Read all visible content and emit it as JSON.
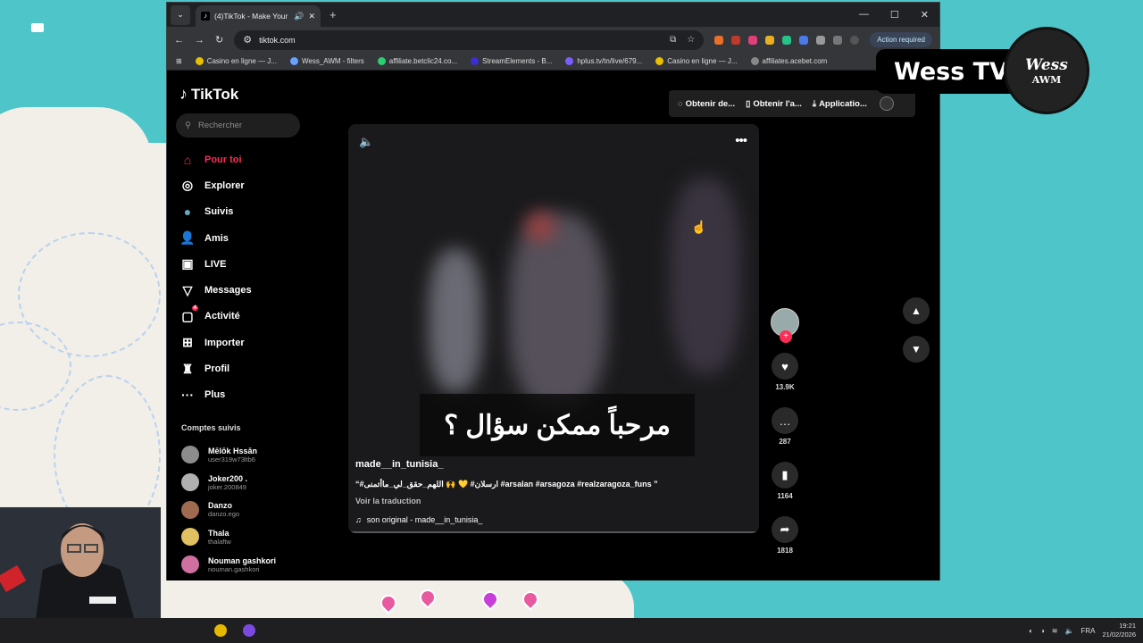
{
  "browser": {
    "tab_title": "(4)TikTok - Make Your Day",
    "url": "tiktok.com",
    "action_required": "Action required",
    "bookmarks": [
      {
        "label": "Casino en ligne — J...",
        "color": "#e8c000"
      },
      {
        "label": "Wess_AWM - filters",
        "color": "#6aa0ff"
      },
      {
        "label": "affiliate.betclic24.co...",
        "color": "#2ecc71"
      },
      {
        "label": "StreamElements - B...",
        "color": "#3a2fd0"
      },
      {
        "label": "hplus.tv/tn/live/679...",
        "color": "#7b5cff"
      },
      {
        "label": "Casino en ligne — J...",
        "color": "#e8c000"
      },
      {
        "label": "affiliates.acebet.com",
        "color": "#888888"
      }
    ]
  },
  "tiktok": {
    "logo": "TikTok",
    "search_placeholder": "Rechercher",
    "nav": [
      {
        "label": "Pour toi",
        "icon": "home-icon",
        "glyph": "⌂",
        "active": true
      },
      {
        "label": "Explorer",
        "icon": "compass-icon",
        "glyph": "◎"
      },
      {
        "label": "Suivis",
        "icon": "following-avatar-icon",
        "glyph": "●"
      },
      {
        "label": "Amis",
        "icon": "friends-icon",
        "glyph": "👤"
      },
      {
        "label": "LIVE",
        "icon": "live-icon",
        "glyph": "▣"
      },
      {
        "label": "Messages",
        "icon": "messages-icon",
        "glyph": "▽"
      },
      {
        "label": "Activité",
        "icon": "activity-icon",
        "glyph": "▢",
        "badge": "4"
      },
      {
        "label": "Importer",
        "icon": "upload-icon",
        "glyph": "⊞"
      },
      {
        "label": "Profil",
        "icon": "profile-icon",
        "glyph": "♜"
      },
      {
        "label": "Plus",
        "icon": "more-icon",
        "glyph": "···"
      }
    ],
    "following_heading": "Comptes suivis",
    "following": [
      {
        "name": "Mēlōk Hssān",
        "handle": "user319w73ltb6",
        "color": "#8c8c8c"
      },
      {
        "name": "Joker200 .",
        "handle": "joker.200849",
        "color": "#b0b0b0"
      },
      {
        "name": "Danzo",
        "handle": "danzo.ego",
        "color": "#a06a50"
      },
      {
        "name": "Thala",
        "handle": "thalaftw",
        "color": "#e0c060"
      },
      {
        "name": "Nouman gashkori",
        "handle": "nouman.gashkori",
        "color": "#d070a0"
      }
    ],
    "top_buttons": [
      "Obtenir de...",
      "Obtenir l'a...",
      "Applicatio..."
    ],
    "video": {
      "subtitle": "مرحباً ممكن سؤال ؟",
      "author": "made__in_tunisia_",
      "caption": "“#ارسلان# 💛 🙌 اللهم_حقق_لي_ماأتمنى #arsalan #arsagoza #realzaragoza_funs ”",
      "translate": "Voir la traduction",
      "sound": "son original - made__in_tunisia_"
    },
    "actions": {
      "likes": "13.9K",
      "comments": "287",
      "saves": "1164",
      "shares": "1818"
    }
  },
  "overlay": {
    "brand_text": "Wess TV",
    "logo_line1": "Wess",
    "logo_line2": "AWM"
  },
  "taskbar": {
    "lang": "FRA",
    "time": "19:21",
    "date": "21/02/2026"
  }
}
